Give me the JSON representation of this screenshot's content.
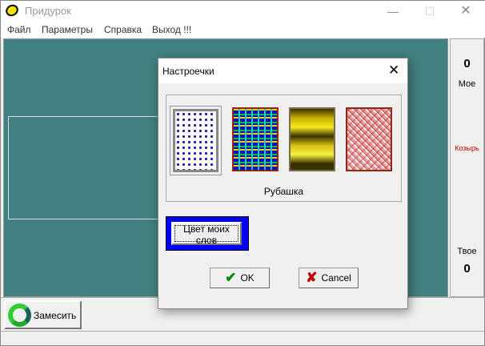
{
  "window": {
    "title": "Придурок",
    "minimize": "—",
    "maximize": "☐",
    "close": "✕"
  },
  "menu": [
    "Файл",
    "Параметры",
    "Справка",
    "Выход !!!"
  ],
  "side": {
    "my_score": "0",
    "my_label": "Мое",
    "trump_label": "Козырь",
    "your_label": "Твое",
    "your_score": "0"
  },
  "toolbar": {
    "shuffle_label": "Замесить"
  },
  "dialog": {
    "title": "Настроечки",
    "close": "✕",
    "card_back_caption": "Рубашка",
    "color_button": "Цвет моих слов",
    "ok": "OK",
    "cancel": "Cancel",
    "selected_card_back": 1
  },
  "colors": {
    "table": "#418080",
    "word_color": "#0000ff"
  }
}
